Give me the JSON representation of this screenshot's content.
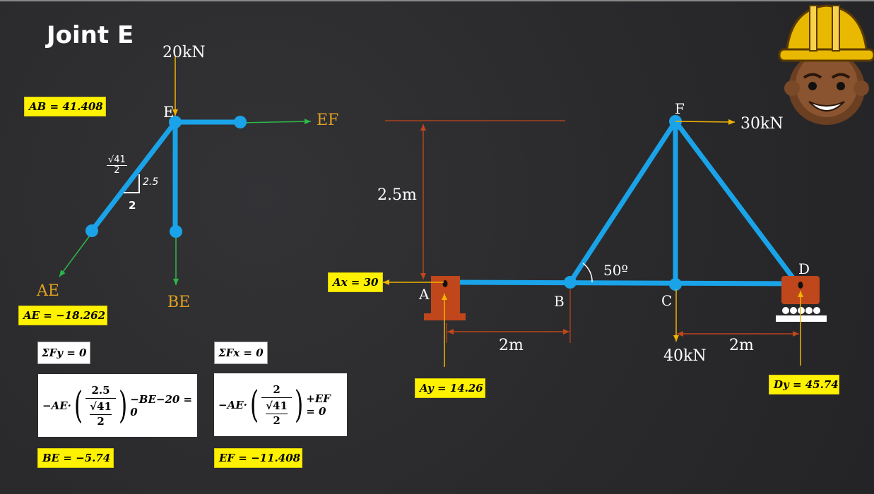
{
  "title": "Joint E",
  "fbd": {
    "load": "20kN",
    "node_e": "E",
    "force_ef": "EF",
    "force_ae": "AE",
    "force_be": "BE",
    "slope_rise": "2.5",
    "slope_run": "2"
  },
  "results": {
    "ab": "AB = 41.408",
    "ae": "AE = −18.262",
    "be": "BE = −5.74",
    "ef": "EF = −11.408"
  },
  "equations": {
    "sum_fy": "ΣFy = 0",
    "sum_fx": "ΣFx = 0",
    "fy_lead": "−AE·",
    "fy_num": "2.5",
    "fy_den_root": "√41",
    "fy_den_div": "2",
    "fy_tail": "−BE−20 = 0",
    "fx_lead": "−AE·",
    "fx_num": "2",
    "fx_den_root": "√41",
    "fx_den_div": "2",
    "fx_tail": "+EF = 0"
  },
  "truss": {
    "height": "2.5m",
    "span_ab": "2m",
    "span_cd": "2m",
    "angle": "50º",
    "load_f": "30kN",
    "load_c": "40kN",
    "node_a": "A",
    "node_b": "B",
    "node_c": "C",
    "node_d": "D",
    "node_f": "F",
    "ax": "Ax = 30",
    "ay": "Ay = 14.26",
    "dy": "Dy = 45.74"
  },
  "colors": {
    "member": "#1aa3e8",
    "support": "#c0461b",
    "highlight": "#fff200",
    "force_arrow": "#f0b400",
    "unknown_arrow": "#2db84a",
    "dimension": "#c0461b"
  },
  "icons": [
    "engineer-avatar-icon"
  ]
}
